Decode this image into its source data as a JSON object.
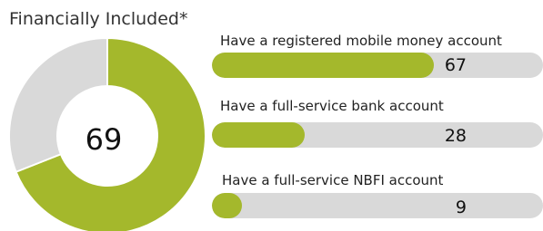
{
  "chart_data": [
    {
      "type": "pie",
      "variant": "donut",
      "title": "Financially Included*",
      "center_label": "69",
      "slices": [
        {
          "label": "",
          "value": 69,
          "color": "#a4b82c"
        },
        {
          "label": "",
          "value": 31,
          "color": "#d9d9d9"
        }
      ]
    },
    {
      "type": "bar",
      "orientation": "horizontal",
      "xlim": [
        0,
        100
      ],
      "track_color": "#d9d9d9",
      "fill_color": "#a4b82c",
      "bars": [
        {
          "label": "Have a registered mobile money account",
          "value": 67,
          "value_label": "67"
        },
        {
          "label": "Have a full-service bank account",
          "value": 28,
          "value_label": "28"
        },
        {
          "label": "Have a full-service NBFI account",
          "value": 9,
          "value_label": "9"
        }
      ]
    }
  ]
}
